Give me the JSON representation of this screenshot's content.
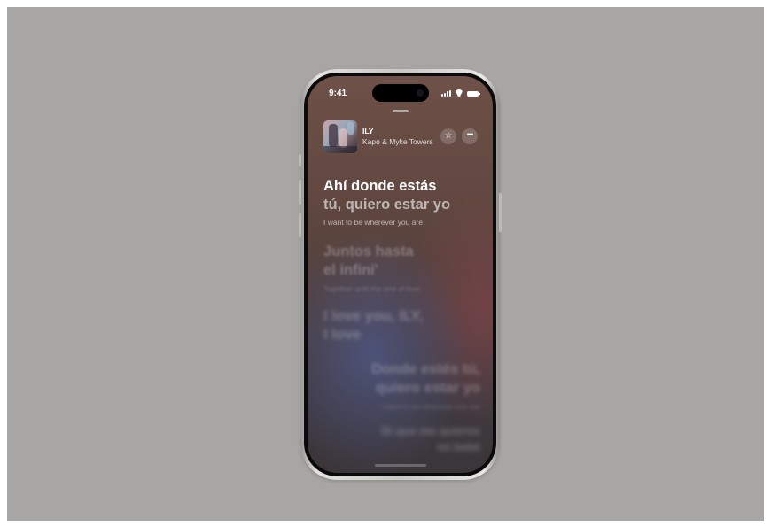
{
  "status_bar": {
    "time": "9:41",
    "icons": [
      "cellular-signal-icon",
      "wifi-icon",
      "battery-icon"
    ]
  },
  "now_playing": {
    "title": "ILY",
    "artist": "Kapo & Myke Towers",
    "favorite_icon": "star-icon",
    "more_icon": "ellipsis-icon"
  },
  "lyrics": {
    "active": {
      "line1": "Ahí donde estás",
      "line2": "tú, quiero estar yo",
      "translation": "I want to be wherever you are"
    },
    "next1": {
      "line1": "Juntos hasta",
      "line2": "el infini'",
      "translation": "Together until the end of love"
    },
    "next2": {
      "line1": "I love you, ILY,",
      "line2": "I love"
    },
    "next3": {
      "line1": "Donde estés tú,",
      "line2": "quiero estar yo",
      "translation": "I want to be wherever you are"
    },
    "next4": {
      "line1": "Di que me quieres",
      "line2": "mi bebé"
    }
  },
  "colors": {
    "backdrop": "#a7a6a5",
    "screen_top": "#6e5149",
    "screen_bottom_blue": "#4e5682",
    "accent_red": "#7d444a"
  }
}
